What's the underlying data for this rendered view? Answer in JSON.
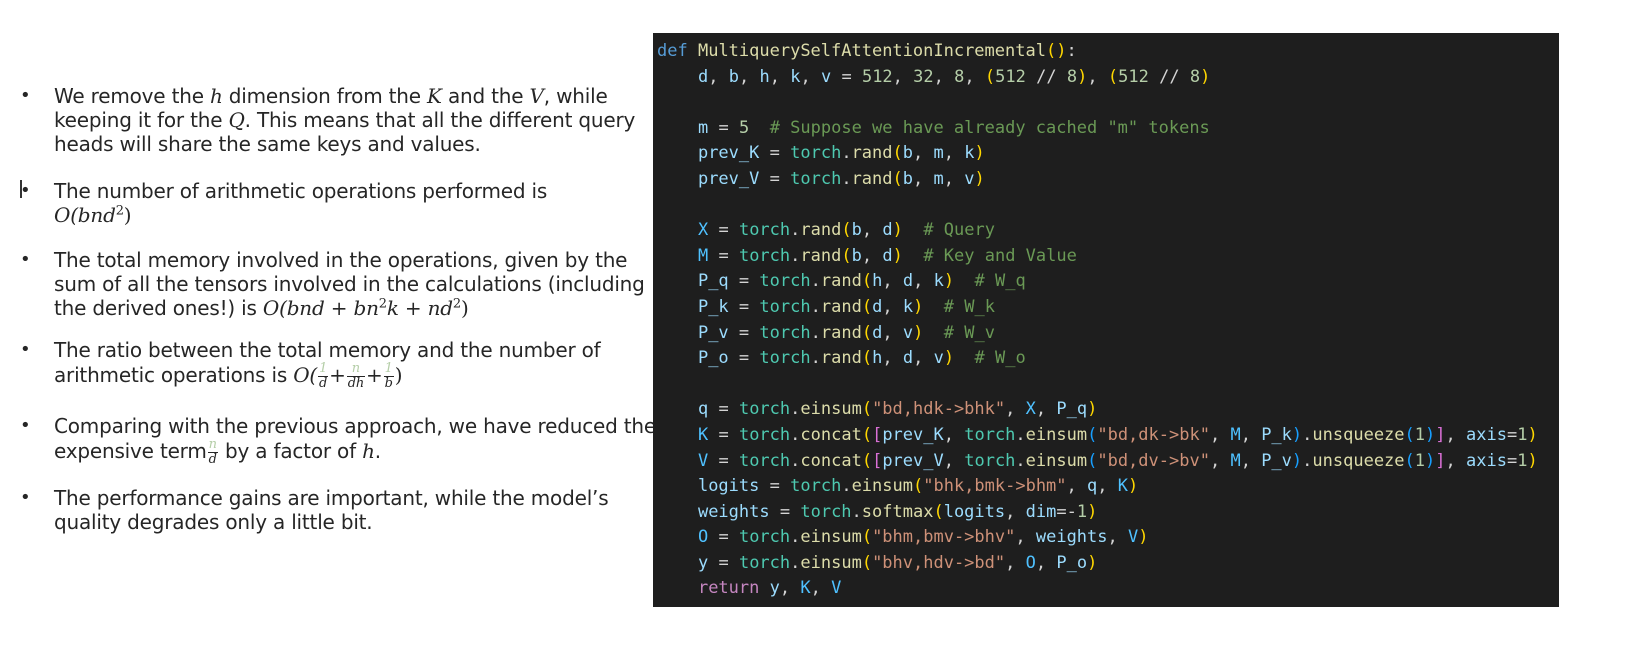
{
  "bullets": {
    "b1": {
      "t1": "We remove the ",
      "h": "h",
      "t2": " dimension from the ",
      "K": "K",
      "t3": " and the ",
      "V": "V",
      "t4": ", while keeping it for the ",
      "Q": "Q",
      "t5": ". This means that all the different query heads will share the same keys and values."
    },
    "b2": {
      "t1": "The number of arithmetic operations performed is",
      "m1": "O(bnd",
      "exp": "2",
      "m2": ")"
    },
    "b3": {
      "t1": "The total memory involved in the operations, given by the sum of all the tensors involved in the calculations (including the derived ones!) is ",
      "m1": "O(bnd + bn",
      "e1": "2",
      "m2": "k + nd",
      "e2": "2",
      "m3": ")"
    },
    "b4": {
      "t1": "The ratio between the total memory and the number of arithmetic operations is ",
      "m1": "O(",
      "f1n": "1",
      "f1d": "d",
      "plus": "+",
      "f2n": "n",
      "f2d": "dh",
      "f3n": "1",
      "f3d": "b",
      "m2": ")"
    },
    "b5": {
      "t1": "Comparing with the previous approach, we have reduced the expensive term",
      "fn": "n",
      "fd": "d",
      "t2": " by a factor of ",
      "h": "h",
      "t3": "."
    },
    "b6": {
      "t1": "The performance gains are important, while the model’s quality degrades only a little bit."
    }
  },
  "code": {
    "lines": [
      "def MultiquerySelfAttentionIncremental():",
      "    d, b, h, k, v = 512, 32, 8, (512 // 8), (512 // 8)",
      "",
      "    m = 5  # Suppose we have already cached \"m\" tokens",
      "    prev_K = torch.rand(b, m, k)",
      "    prev_V = torch.rand(b, m, v)",
      "",
      "    X = torch.rand(b, d)  # Query",
      "    M = torch.rand(b, d)  # Key and Value",
      "    P_q = torch.rand(h, d, k)  # W_q",
      "    P_k = torch.rand(d, k)  # W_k",
      "    P_v = torch.rand(d, v)  # W_v",
      "    P_o = torch.rand(h, d, v)  # W_o",
      "",
      "    q = torch.einsum(\"bd,hdk->bhk\", X, P_q)",
      "    K = torch.concat([prev_K, torch.einsum(\"bd,dk->bk\", M, P_k).unsqueeze(1)], axis=1)",
      "    V = torch.concat([prev_V, torch.einsum(\"bd,dv->bv\", M, P_v).unsqueeze(1)], axis=1)",
      "    logits = torch.einsum(\"bhk,bmk->bhm\", q, K)",
      "    weights = torch.softmax(logits, dim=-1)",
      "    O = torch.einsum(\"bhm,bmv->bhv\", weights, V)",
      "    y = torch.einsum(\"bhv,hdv->bd\", O, P_o)",
      "    return y, K, V"
    ]
  },
  "colors": {
    "code_background": "#1e1e1e",
    "keyword": "#569cd6",
    "function": "#dcdcaa",
    "string": "#ce9178",
    "comment": "#6a9955",
    "number": "#b5cea8"
  }
}
